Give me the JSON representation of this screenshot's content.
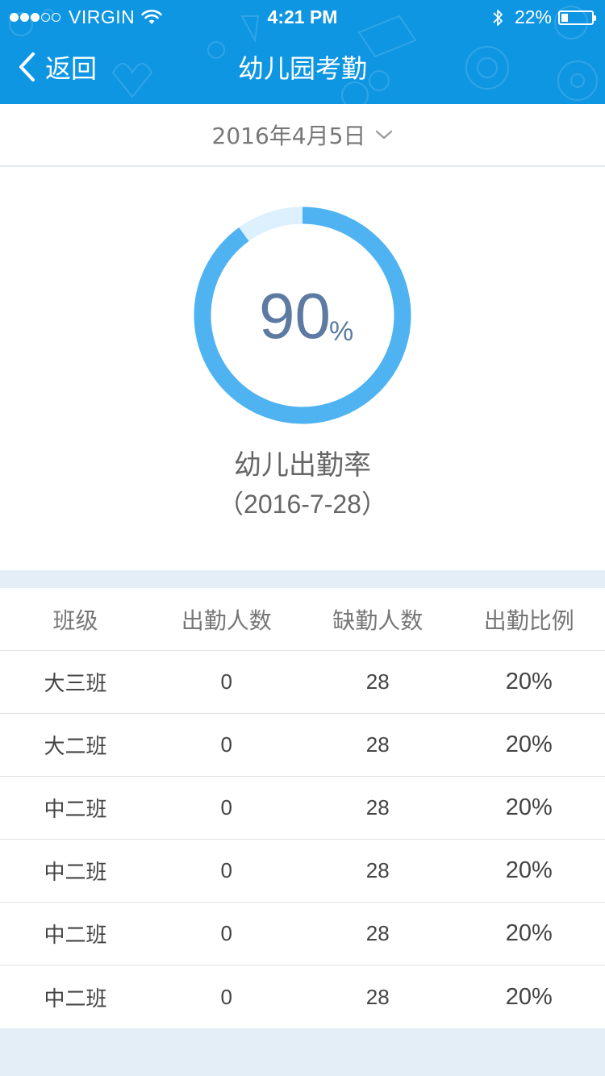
{
  "status_bar": {
    "carrier": "VIRGIN",
    "time": "4:21 PM",
    "battery": "22%",
    "battery_level": 0.22,
    "signal_bars": 3,
    "icons": [
      "wifi-icon",
      "bluetooth-icon",
      "battery-icon"
    ]
  },
  "nav": {
    "back_label": "返回",
    "title": "幼儿园考勤",
    "back_icon": "chevron-left-icon"
  },
  "date_selector": {
    "value": "2016年4月5日",
    "icon": "chevron-down-icon"
  },
  "summary": {
    "rate_value": "90",
    "rate_unit": "%",
    "rate_fraction": 0.9,
    "label": "幼儿出勤率",
    "date": "（2016-7-28）"
  },
  "table": {
    "headers": [
      "班级",
      "出勤人数",
      "缺勤人数",
      "出勤比例"
    ],
    "rows": [
      [
        "大三班",
        "0",
        "28",
        "20%"
      ],
      [
        "大二班",
        "0",
        "28",
        "20%"
      ],
      [
        "中二班",
        "0",
        "28",
        "20%"
      ],
      [
        "中二班",
        "0",
        "28",
        "20%"
      ],
      [
        "中二班",
        "0",
        "28",
        "20%"
      ],
      [
        "中二班",
        "0",
        "28",
        "20%"
      ]
    ]
  },
  "colors": {
    "header_bg": "#0f96e3",
    "ring_progress": "#4fb3f2",
    "ring_track": "#dcf0fd",
    "rate_text": "#5c7aa2",
    "page_bg": "#e4eef6"
  }
}
